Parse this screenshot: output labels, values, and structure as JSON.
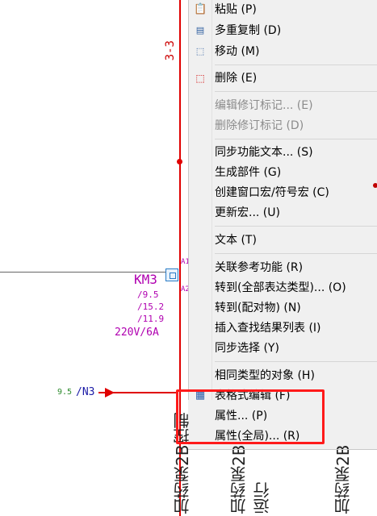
{
  "schematic": {
    "sheet_ref": "3-3",
    "component_name": "KM3",
    "pin_a1": "A1",
    "pin_a2": "A2",
    "refs": [
      "/9.5",
      "/15.2",
      "/11.9"
    ],
    "rating": "220V/6A",
    "wire_ref": "9.5",
    "wire_label": "/N3",
    "vertical_labels": [
      "加药泵2B控制",
      "加药泵2B运行",
      "加药泵2B"
    ],
    "colors": {
      "wire": "#e00000",
      "label": "#b000b0",
      "highlight": "#ff1a1a"
    }
  },
  "menu": {
    "items": [
      {
        "label": "粘贴 (P)",
        "icon": "paste-icon"
      },
      {
        "label": "多重复制 (D)",
        "icon": "multi-copy-icon"
      },
      {
        "label": "移动 (M)",
        "icon": "move-icon"
      },
      {
        "label": "删除 (E)",
        "icon": "delete-icon"
      },
      {
        "label": "编辑修订标记... (E)",
        "disabled": true
      },
      {
        "label": "删除修订标记 (D)",
        "disabled": true
      },
      {
        "label": "同步功能文本... (S)"
      },
      {
        "label": "生成部件 (G)"
      },
      {
        "label": "创建窗口宏/符号宏 (C)"
      },
      {
        "label": "更新宏... (U)"
      },
      {
        "label": "文本 (T)"
      },
      {
        "label": "关联参考功能 (R)"
      },
      {
        "label": "转到(全部表达类型)... (O)"
      },
      {
        "label": "转到(配对物) (N)"
      },
      {
        "label": "插入查找结果列表 (I)"
      },
      {
        "label": "同步选择 (Y)"
      },
      {
        "label": "相同类型的对象 (H)"
      },
      {
        "label": "表格式编辑 (F)",
        "icon": "table-edit-icon"
      },
      {
        "label": "属性... (P)"
      },
      {
        "label": "属性(全局)... (R)"
      }
    ]
  }
}
